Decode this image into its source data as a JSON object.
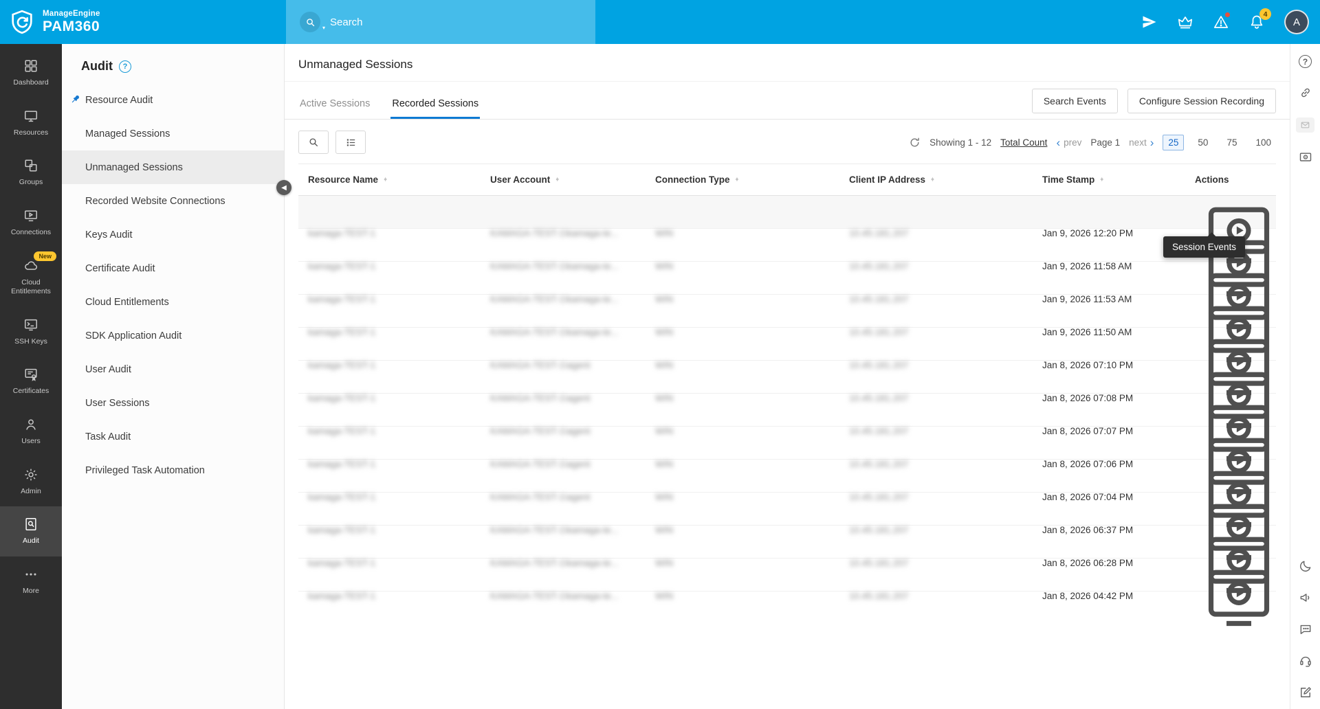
{
  "colors": {
    "header_blue": "#00a3e2",
    "accent_blue": "#1668c7",
    "tab_underline": "#0e7ad3",
    "badge_yellow": "#fdc62f",
    "alert_red": "#e8503a",
    "sidebar_dark": "#2e2e2e"
  },
  "header": {
    "brand_top": "ManageEngine",
    "brand_bottom": "PAM360",
    "search_placeholder": "Search",
    "notifications_count": "4",
    "avatar_initial": "A"
  },
  "left_nav": {
    "items": [
      {
        "label": "Dashboard"
      },
      {
        "label": "Resources"
      },
      {
        "label": "Groups"
      },
      {
        "label": "Connections"
      },
      {
        "label": "Cloud Entitlements",
        "badge": "New"
      },
      {
        "label": "SSH Keys"
      },
      {
        "label": "Certificates"
      },
      {
        "label": "Users"
      },
      {
        "label": "Admin"
      },
      {
        "label": "Audit",
        "active": true
      },
      {
        "label": "More"
      }
    ]
  },
  "sidebar": {
    "title": "Audit",
    "help_glyph": "?",
    "items": [
      {
        "label": "Resource Audit",
        "pinned": true
      },
      {
        "label": "Managed Sessions"
      },
      {
        "label": "Unmanaged Sessions",
        "active": true
      },
      {
        "label": "Recorded Website Connections"
      },
      {
        "label": "Keys Audit"
      },
      {
        "label": "Certificate Audit"
      },
      {
        "label": "Cloud Entitlements"
      },
      {
        "label": "SDK Application Audit"
      },
      {
        "label": "User Audit"
      },
      {
        "label": "User Sessions"
      },
      {
        "label": "Task Audit"
      },
      {
        "label": "Privileged Task Automation"
      }
    ]
  },
  "main": {
    "page_title": "Unmanaged Sessions",
    "tabs": [
      {
        "label": "Active Sessions"
      },
      {
        "label": "Recorded Sessions",
        "active": true
      }
    ],
    "buttons": {
      "search_events": "Search Events",
      "configure_session_recording": "Configure Session Recording"
    },
    "pagination": {
      "showing_text": "Showing 1 - 12",
      "total_count_link": "Total Count",
      "prev_chevron": "‹",
      "prev_label": "prev",
      "page_label": "Page 1",
      "next_label": "next",
      "next_chevron": "›",
      "page_sizes": [
        "25",
        "50",
        "75",
        "100"
      ],
      "selected_page_size": "25"
    },
    "tooltip": "Session Events",
    "table": {
      "columns": [
        "Resource Name",
        "User Account",
        "Connection Type",
        "Client IP Address",
        "Time Stamp",
        "Actions"
      ],
      "redacted_note": "resource, user account, connection type and IP values are blurred in source",
      "rows": [
        {
          "resource": "kamaga-TEST-1",
          "user": "KAMAGA-TEST-1\\kamaga-te...",
          "type": "WIN",
          "ip": "10.45.181.207",
          "time": "Jan 9, 2026 12:20 PM"
        },
        {
          "resource": "kamaga-TEST-1",
          "user": "KAMAGA-TEST-1\\kamaga-te...",
          "type": "WIN",
          "ip": "10.45.181.207",
          "time": "Jan 9, 2026 11:58 AM"
        },
        {
          "resource": "kamaga-TEST-1",
          "user": "KAMAGA-TEST-1\\kamaga-te...",
          "type": "WIN",
          "ip": "10.45.181.207",
          "time": "Jan 9, 2026 11:53 AM"
        },
        {
          "resource": "kamaga-TEST-1",
          "user": "KAMAGA-TEST-1\\kamaga-te...",
          "type": "WIN",
          "ip": "10.45.181.207",
          "time": "Jan 9, 2026 11:50 AM"
        },
        {
          "resource": "kamaga-TEST-1",
          "user": "KAMAGA-TEST-1\\agent",
          "type": "WIN",
          "ip": "10.45.181.207",
          "time": "Jan 8, 2026 07:10 PM"
        },
        {
          "resource": "kamaga-TEST-1",
          "user": "KAMAGA-TEST-1\\agent",
          "type": "WIN",
          "ip": "10.45.181.207",
          "time": "Jan 8, 2026 07:08 PM"
        },
        {
          "resource": "kamaga-TEST-1",
          "user": "KAMAGA-TEST-1\\agent",
          "type": "WIN",
          "ip": "10.45.181.207",
          "time": "Jan 8, 2026 07:07 PM"
        },
        {
          "resource": "kamaga-TEST-1",
          "user": "KAMAGA-TEST-1\\agent",
          "type": "WIN",
          "ip": "10.45.181.207",
          "time": "Jan 8, 2026 07:06 PM"
        },
        {
          "resource": "kamaga-TEST-1",
          "user": "KAMAGA-TEST-1\\agent",
          "type": "WIN",
          "ip": "10.45.181.207",
          "time": "Jan 8, 2026 07:04 PM"
        },
        {
          "resource": "kamaga-TEST-1",
          "user": "KAMAGA-TEST-1\\kamaga-te...",
          "type": "WIN",
          "ip": "10.45.181.207",
          "time": "Jan 8, 2026 06:37 PM"
        },
        {
          "resource": "kamaga-TEST-1",
          "user": "KAMAGA-TEST-1\\kamaga-te...",
          "type": "WIN",
          "ip": "10.45.181.207",
          "time": "Jan 8, 2026 06:28 PM"
        },
        {
          "resource": "kamaga-TEST-1",
          "user": "KAMAGA-TEST-1\\kamaga-te...",
          "type": "WIN",
          "ip": "10.45.181.207",
          "time": "Jan 8, 2026 04:42 PM"
        }
      ]
    }
  },
  "right_rail": {
    "icons": [
      "help",
      "link",
      "mail",
      "session-recording",
      "dark-mode",
      "announcement",
      "chat",
      "support",
      "feedback"
    ]
  }
}
